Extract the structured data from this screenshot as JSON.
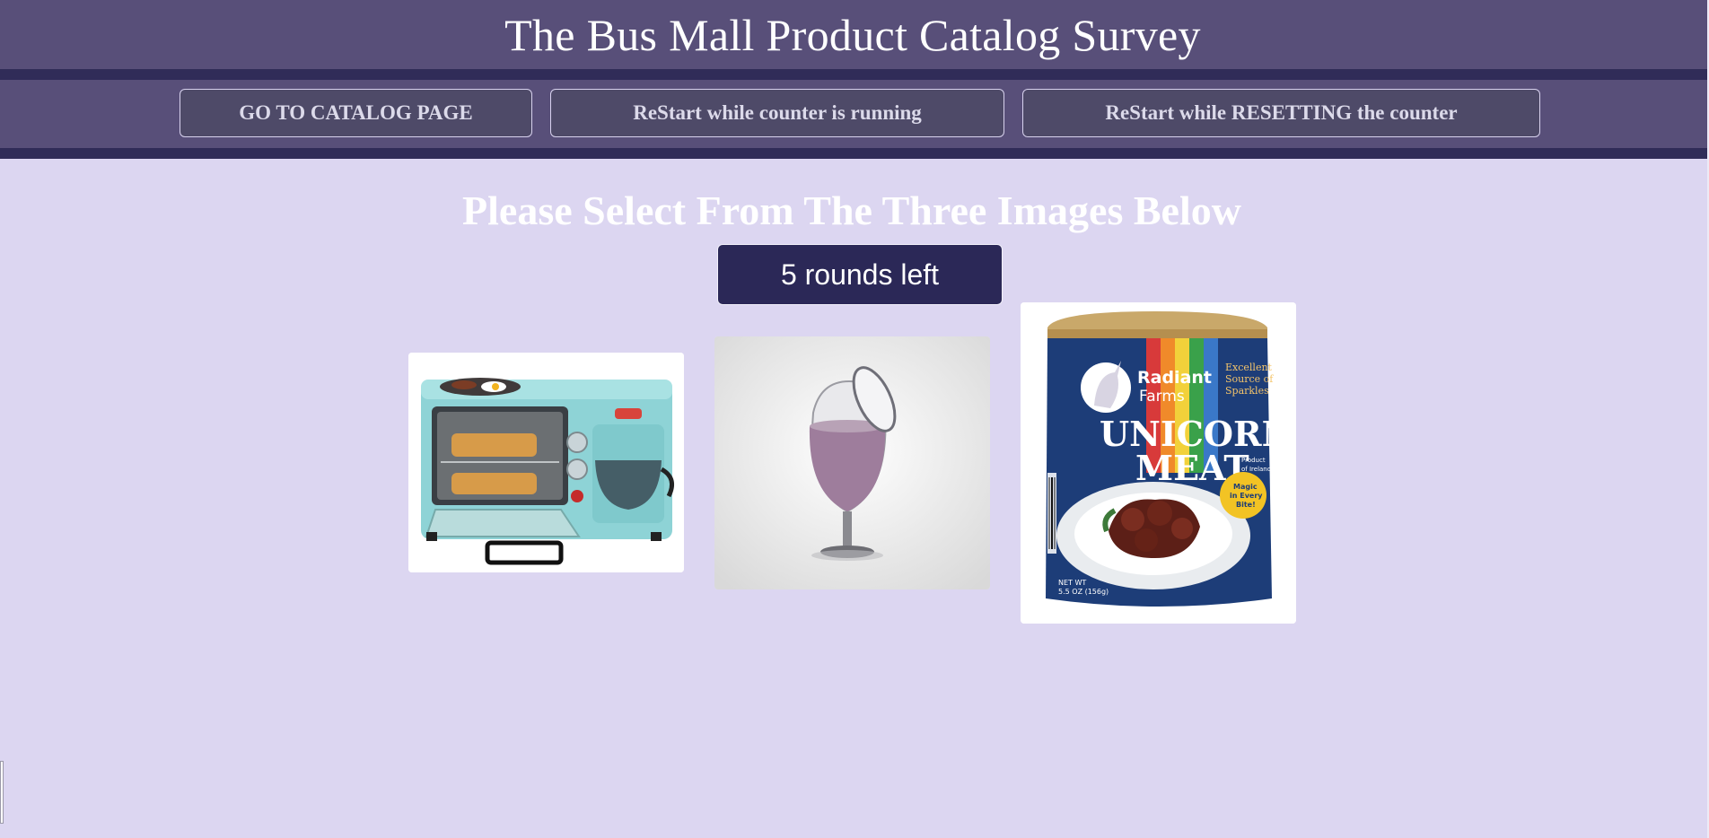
{
  "header": {
    "title": "The Bus Mall Product Catalog Survey"
  },
  "nav": {
    "catalog_label": "GO TO CATALOG PAGE",
    "restart_label": "ReStart while counter is running",
    "reset_label": "ReStart while RESETTING the counter"
  },
  "main": {
    "heading": "Please Select From The Three Images Below",
    "rounds_left": "5 rounds left",
    "products": [
      {
        "icon": "breakfast-maker-image"
      },
      {
        "icon": "wine-glass-image"
      },
      {
        "icon": "unicorn-meat-can-image",
        "can_text": [
          "Radiant",
          "Farms",
          "UNICORN",
          "MEAT",
          "Excellent",
          "Source of",
          "Sparkles",
          "Product",
          "of Ireland",
          "Magic",
          "in Every",
          "Bite!",
          "NET WT",
          "5.5 OZ (156g)"
        ]
      }
    ]
  },
  "colors": {
    "page_bg": "#dcd6f1",
    "header_bg": "#584f79",
    "band_dark": "#302c58",
    "counter_bg": "#2b2857",
    "button_bg": "#4e4a68"
  }
}
